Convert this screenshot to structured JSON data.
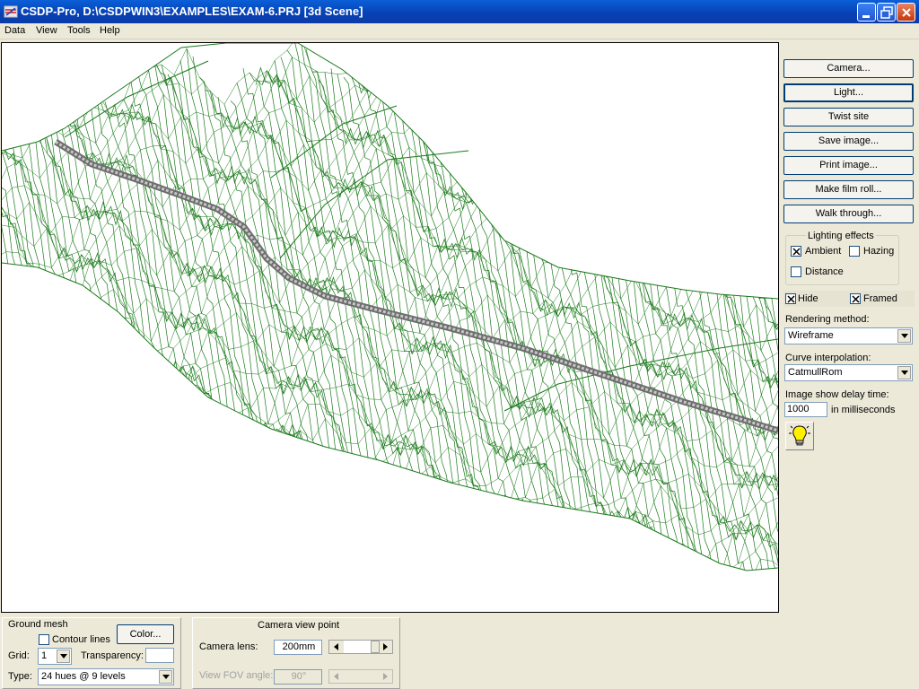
{
  "window": {
    "title": "CSDP-Pro, D:\\CSDPWIN3\\EXAMPLES\\EXAM-6.PRJ [3d Scene]",
    "icon": "app-icon",
    "controls": [
      "minimize-icon",
      "restore-icon",
      "close-icon"
    ]
  },
  "menu": [
    "Data",
    "View",
    "Tools",
    "Help"
  ],
  "scene": {
    "rendering": "wireframe terrain mesh with road alignment",
    "mesh_color": "#1A7A1A",
    "road_color": "#8C8C8C"
  },
  "buttons": {
    "camera": "Camera...",
    "light": "Light...",
    "twist": "Twist site",
    "save_image": "Save image...",
    "print_image": "Print image...",
    "film_roll": "Make film roll...",
    "walk": "Walk through..."
  },
  "lighting": {
    "title": "Lighting effects",
    "ambient": {
      "label": "Ambient",
      "checked": true
    },
    "hazing": {
      "label": "Hazing",
      "checked": false
    },
    "distance": {
      "label": "Distance",
      "checked": false
    }
  },
  "hide": {
    "label": "Hide",
    "checked": true
  },
  "framed": {
    "label": "Framed",
    "checked": true
  },
  "rendering_method": {
    "label": "Rendering method:",
    "value": "Wireframe"
  },
  "curve_interp": {
    "label": "Curve interpolation:",
    "value": "CatmullRom"
  },
  "delay": {
    "label": "Image show delay time:",
    "value": "1000",
    "unit": "in milliseconds"
  },
  "light_bulb_icon": "lightbulb-icon",
  "ground_mesh": {
    "title": "Ground mesh",
    "contour_lines": {
      "label": "Contour lines",
      "checked": false
    },
    "color_button": "Color...",
    "grid_label": "Grid:",
    "grid_value": "1",
    "transparency_label": "Transparency:",
    "transparency_value": "",
    "type_label": "Type:",
    "type_value": "24 hues @ 9 levels"
  },
  "camera_view": {
    "title": "Camera view point",
    "lens_label": "Camera lens:",
    "lens_value": "200mm",
    "fov_label": "View FOV angle:",
    "fov_value": "90°"
  },
  "colors": {
    "titlebar": "#0842B5",
    "face": "#ECE9D8",
    "mesh": "#1A7A1A"
  }
}
